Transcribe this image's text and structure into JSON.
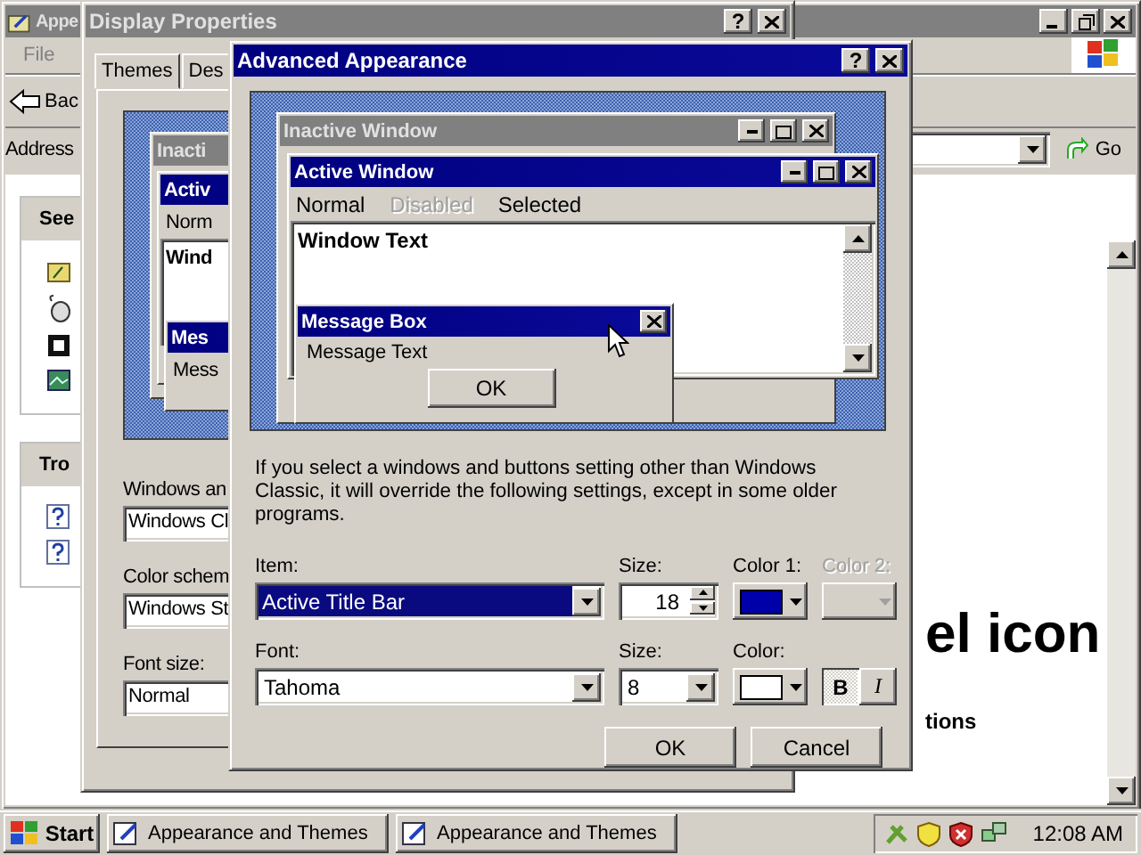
{
  "explorer": {
    "title": "Appe",
    "menu": [
      "File"
    ],
    "back_label": "Bac",
    "address_label": "Address",
    "go_label": "Go",
    "panels": [
      {
        "heading": "See",
        "kind": "tasks"
      },
      {
        "heading": "Tro",
        "kind": "help"
      }
    ],
    "heading": "el icon",
    "subheading": "tions"
  },
  "display_properties": {
    "title": "Display Properties",
    "help_glyph": "?",
    "tabs": [
      {
        "label": "Themes",
        "selected": false
      },
      {
        "label": "Des",
        "selected": false
      }
    ],
    "preview": {
      "inactive_title": "Inacti",
      "active_title": "Activ",
      "menu_item": "Norm",
      "window_text": "Wind",
      "message_title": "Mes",
      "message_text": "Mess"
    },
    "fields": [
      {
        "label": "Windows an",
        "value": "Windows Cl"
      },
      {
        "label": "Color schem",
        "value": "Windows St"
      },
      {
        "label": "Font size:",
        "value": "Normal"
      }
    ]
  },
  "advanced_appearance": {
    "title": "Advanced Appearance",
    "help_glyph": "?",
    "preview": {
      "inactive_title": "Inactive Window",
      "active_title": "Active Window",
      "menu": [
        {
          "label": "Normal",
          "disabled": false
        },
        {
          "label": "Disabled",
          "disabled": true
        },
        {
          "label": "Selected",
          "disabled": false
        }
      ],
      "window_text": "Window Text",
      "message_title": "Message Box",
      "message_text": "Message Text",
      "ok_label": "OK"
    },
    "note": "If you select a windows and buttons setting other than Windows Classic, it will override the following settings, except in some older programs.",
    "item": {
      "label": "Item:",
      "value": "Active Title Bar"
    },
    "item_size": {
      "label": "Size:",
      "value": "18"
    },
    "color1": {
      "label": "Color 1:",
      "color": "#0000a8"
    },
    "color2": {
      "label": "Color 2:",
      "disabled": true
    },
    "font": {
      "label": "Font:",
      "value": "Tahoma"
    },
    "font_size": {
      "label": "Size:",
      "value": "8"
    },
    "font_color": {
      "label": "Color:",
      "color": "#ffffff"
    },
    "styles": [
      {
        "label": "B",
        "kind": "bold",
        "selected": true
      },
      {
        "label": "I",
        "kind": "italic",
        "selected": false
      }
    ],
    "buttons": [
      "OK",
      "Cancel"
    ]
  },
  "taskbar": {
    "start": "Start",
    "tasks": [
      "Appearance and Themes",
      "Appearance and Themes"
    ],
    "clock": "12:08 AM"
  }
}
